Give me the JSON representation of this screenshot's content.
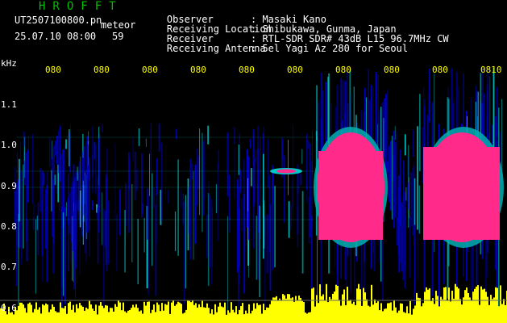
{
  "header": {
    "title": "HROFFT",
    "filename": "UT2507100800.pn",
    "meteor_label": "meteor",
    "datetime": "25.07.10 08:00",
    "seconds": "59",
    "info": [
      {
        "label": "Observer",
        "value": ": Masaki Kano"
      },
      {
        "label": "Receiving Location",
        "value": ": Shibukawa, Gunma, Japan"
      },
      {
        "label": "Receiver",
        "value": ": RTL-SDR SDR# 43dB L15 96.7MHz CW"
      },
      {
        "label": "Receiving Antenna",
        "value": ": 5el Yagi Az 280 for Seoul"
      }
    ]
  },
  "axis": {
    "unit": "kHz",
    "y_ticks": [
      "1.1",
      "1.0",
      "0.9",
      "0.8",
      "0.7",
      "0.6"
    ],
    "time_labels": [
      "080",
      "080",
      "080",
      "080",
      "080",
      "080",
      "080",
      "080",
      "080",
      "0810"
    ]
  },
  "colors": {
    "background": "#000000",
    "weak": "#0000c8",
    "medium": "#00c8c8",
    "strong": "#ff2a8a",
    "level": "#ffff00",
    "title": "#00c000"
  }
}
